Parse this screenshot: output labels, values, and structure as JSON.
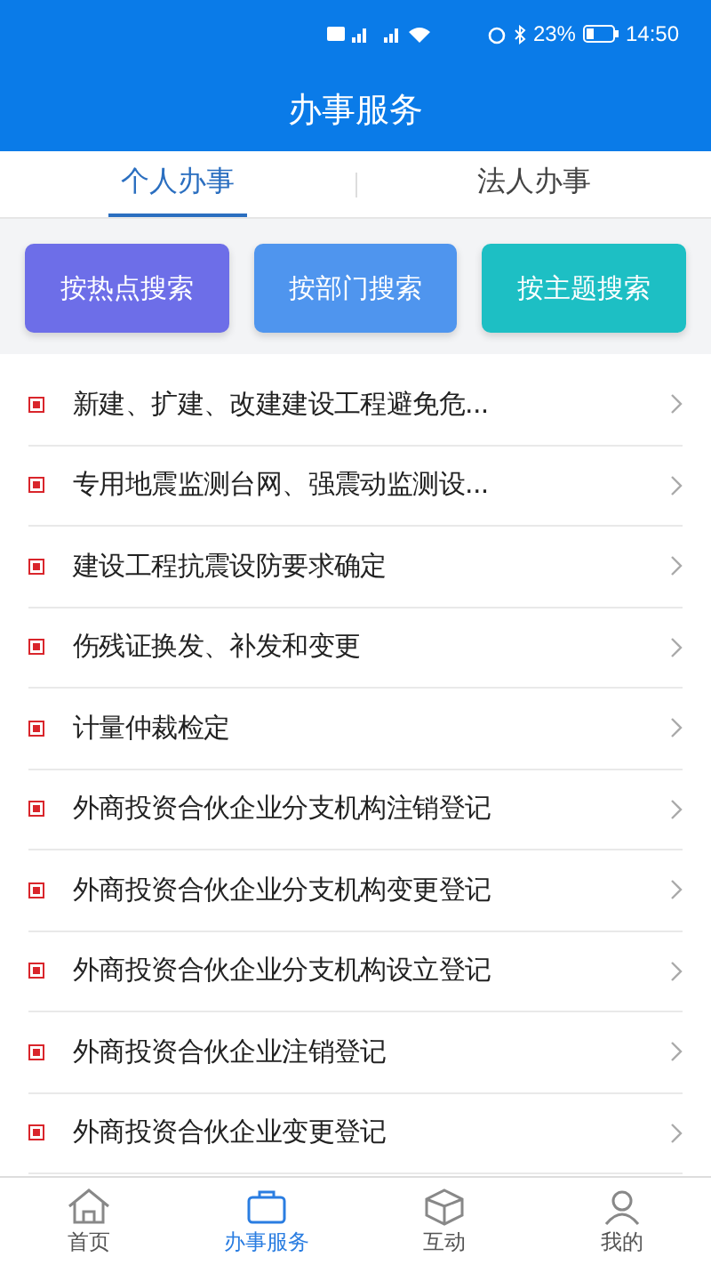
{
  "status_bar": {
    "battery": "23%",
    "time": "14:50"
  },
  "header": {
    "title": "办事服务"
  },
  "tabs": [
    {
      "label": "个人办事",
      "selected": true
    },
    {
      "label": "法人办事",
      "selected": false
    }
  ],
  "search_buttons": [
    {
      "label": "按热点搜索",
      "color": "#6d6ee8"
    },
    {
      "label": "按部门搜索",
      "color": "#4f95ee"
    },
    {
      "label": "按主题搜索",
      "color": "#1dbfc4"
    }
  ],
  "items": [
    {
      "label": "新建、扩建、改建建设工程避免危..."
    },
    {
      "label": "专用地震监测台网、强震动监测设..."
    },
    {
      "label": "建设工程抗震设防要求确定"
    },
    {
      "label": "伤残证换发、补发和变更"
    },
    {
      "label": "计量仲裁检定"
    },
    {
      "label": "外商投资合伙企业分支机构注销登记"
    },
    {
      "label": "外商投资合伙企业分支机构变更登记"
    },
    {
      "label": "外商投资合伙企业分支机构设立登记"
    },
    {
      "label": "外商投资合伙企业注销登记"
    },
    {
      "label": "外商投资合伙企业变更登记"
    }
  ],
  "nav": [
    {
      "label": "首页",
      "kind": "home",
      "selected": false
    },
    {
      "label": "办事服务",
      "kind": "service",
      "selected": true
    },
    {
      "label": "互动",
      "kind": "chat",
      "selected": false
    },
    {
      "label": "我的",
      "kind": "user",
      "selected": false
    }
  ]
}
